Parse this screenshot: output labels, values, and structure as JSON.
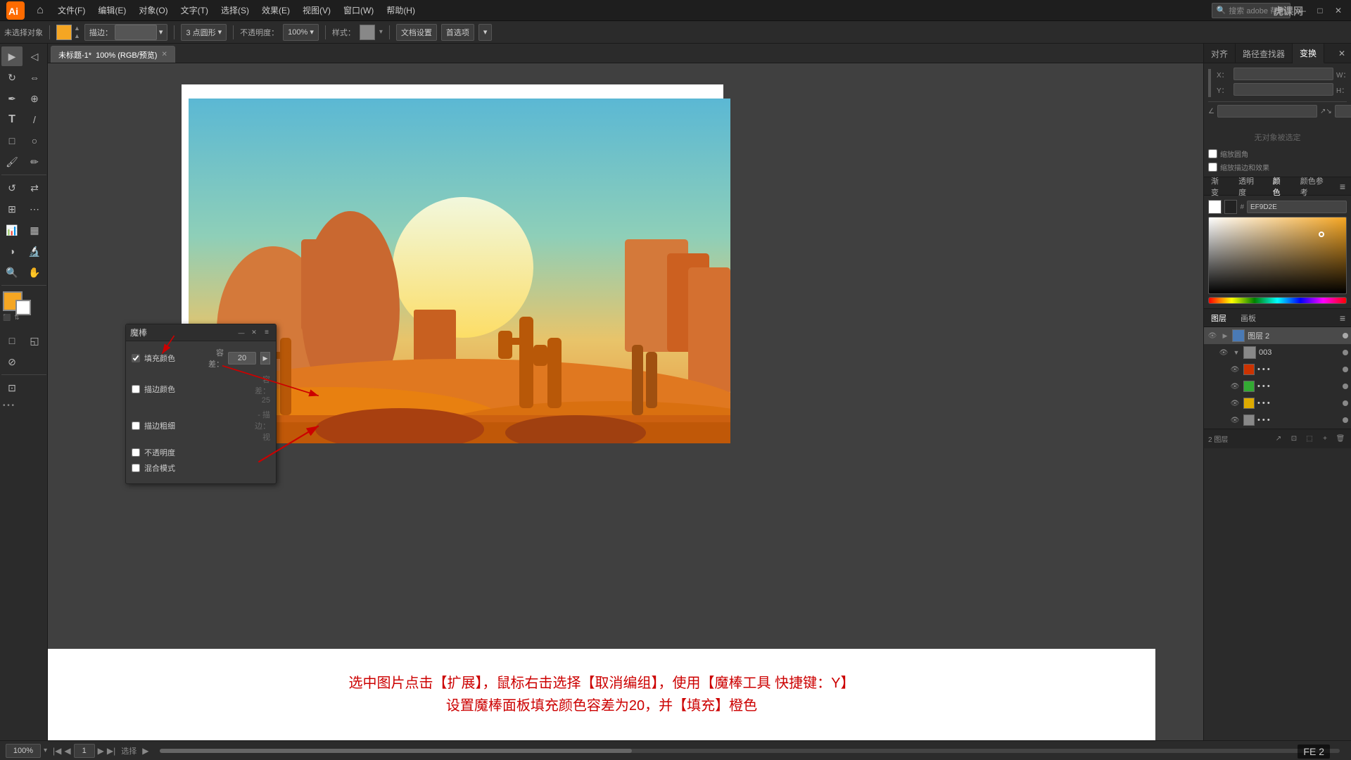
{
  "app": {
    "title": "Adobe Illustrator",
    "logo_text": "Ai"
  },
  "menu": {
    "items": [
      "文件(F)",
      "编辑(E)",
      "对象(O)",
      "文字(T)",
      "选择(S)",
      "效果(E)",
      "视图(V)",
      "窗口(W)",
      "帮助(H)"
    ]
  },
  "toolbar": {
    "label_unselected": "未选择对象",
    "stroke_label": "描边：",
    "point_label": "3 点圆形",
    "opacity_label": "不透明度：",
    "opacity_value": "100%",
    "style_label": "样式：",
    "doc_settings_label": "文档设置",
    "preferences_label": "首选项"
  },
  "tab": {
    "filename": "未标题-1*",
    "view": "100% (RGB/预览)"
  },
  "magic_wand": {
    "title": "魔棒",
    "fill_color_label": "填充颜色",
    "fill_color_checked": true,
    "tolerance_label": "容差：",
    "tolerance_value": "20",
    "stroke_color_label": "描边颜色",
    "stroke_color_checked": false,
    "stroke_tolerance_label": "容差：",
    "stroke_tolerance_value": "25",
    "stroke_width_label": "描边粗细",
    "stroke_width_checked": false,
    "opacity_label": "不透明度",
    "opacity_checked": false,
    "blend_mode_label": "混合模式",
    "blend_mode_checked": false
  },
  "annotation": {
    "line1": "选中图片点击【扩展】，鼠标右击选择【取消编组】，使用【魔棒工具 快捷键：Y】",
    "line2": "设置魔棒面板填充颜色容差为20，并【填充】橙色"
  },
  "right_panel": {
    "tabs": [
      "对齐",
      "路径查找器",
      "变换"
    ],
    "active_tab": "变换",
    "no_selection": "无对象被选定",
    "transform_fields": {
      "x_label": "X：",
      "y_label": "Y：",
      "w_label": "W：",
      "h_label": "H："
    }
  },
  "color_panel": {
    "hash_label": "#",
    "hex_value": "EF9D2E",
    "tabs": [
      "渐变",
      "透明度",
      "颜色",
      "颜色参考"
    ],
    "active_tab": "颜色"
  },
  "layers_panel": {
    "tabs": [
      "图层",
      "画板"
    ],
    "active_tab": "图层",
    "layer2_label": "图层 2",
    "layer_003_label": "003",
    "status_label": "2 图层",
    "colors": [
      "#cc3300",
      "#33aa33",
      "#ddaa00",
      "#888888"
    ]
  },
  "status_bar": {
    "zoom_value": "100%",
    "page_value": "1",
    "selection_label": "选择",
    "video_label": "FE 2"
  },
  "watermark": {
    "text": "虎课网"
  }
}
